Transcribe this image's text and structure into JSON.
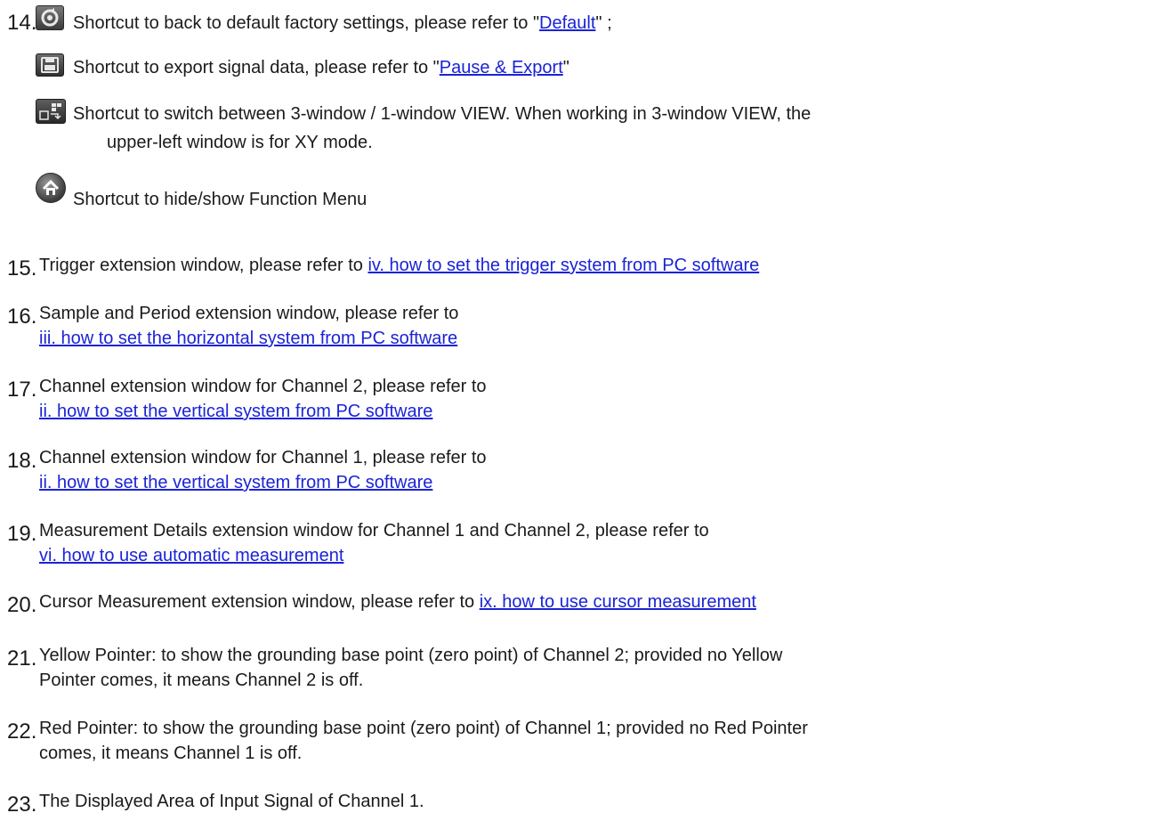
{
  "items": [
    {
      "num": "14.",
      "lines": []
    },
    {
      "num": "15.",
      "text": "Trigger extension window, please refer to ",
      "link": "iv. how to set the trigger system from PC software"
    },
    {
      "num": "16.",
      "text": "Sample and Period extension window, please refer to",
      "link": "iii. how to set the horizontal system from PC software"
    },
    {
      "num": "17.",
      "text": "Channel extension window for Channel 2, please refer to",
      "link": "ii. how to set the vertical system from PC software"
    },
    {
      "num": "18.",
      "text": "Channel extension window for Channel 1, please refer to",
      "link": "ii. how to set the vertical system from PC software"
    },
    {
      "num": "19.",
      "text": "Measurement Details extension window for Channel 1 and Channel 2, please refer to",
      "link": "vi. how to use automatic measurement"
    },
    {
      "num": "20.",
      "text": "Cursor Measurement extension window, please refer to ",
      "link": "ix. how to use cursor measurement"
    },
    {
      "num": "21.",
      "line1": "Yellow Pointer: to show the grounding base point (zero point) of Channel 2; provided no Yellow",
      "line2": "Pointer comes, it means Channel 2 is off."
    },
    {
      "num": "22.",
      "line1": "Red Pointer: to show the grounding base point (zero point) of Channel 1; provided no Red Pointer",
      "line2": "comes, it means Channel 1 is off."
    },
    {
      "num": "23.",
      "text": "The Displayed Area of Input Signal of Channel 1."
    }
  ],
  "shortcuts": {
    "default": {
      "icon": "default-settings-icon",
      "pre": "Shortcut to back to default factory settings, please refer to \"",
      "link": "Default",
      "post": "\" ;"
    },
    "export": {
      "icon": "save-disk-icon",
      "pre": "Shortcut to export signal data, please refer to \"",
      "link": "Pause & Export",
      "post": "\""
    },
    "view": {
      "icon": "window-view-icon",
      "line1": "Shortcut to switch between 3-window / 1-window VIEW. When working in 3-window VIEW, the",
      "line2": "upper-left window is for XY mode."
    },
    "menu": {
      "icon": "home-icon",
      "text": "Shortcut to hide/show Function Menu"
    }
  },
  "colors": {
    "link": "#1a23d6",
    "text": "#1a1a1a"
  }
}
